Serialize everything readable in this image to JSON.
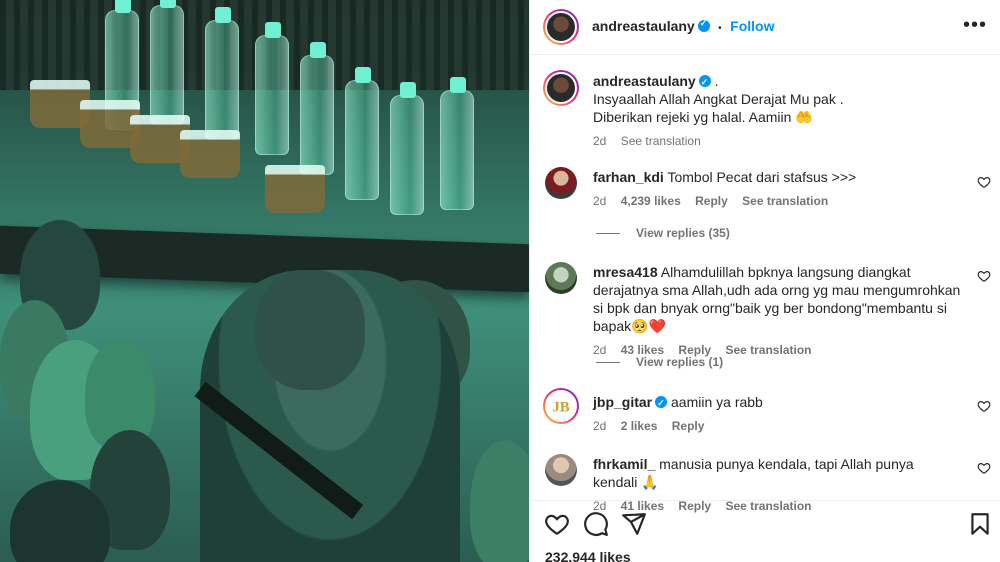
{
  "post": {
    "author": "andreastaulany",
    "follow_label": "Follow",
    "separator": "•",
    "more_label": "•••",
    "likes": "232.944 likes"
  },
  "caption": {
    "author": "andreastaulany",
    "dot": ".",
    "line1": "Insyaallah Allah Angkat Derajat Mu pak .",
    "line2": "Diberikan rejeki yg halal. Aamiin 🤲",
    "time": "2d",
    "see_translation": "See translation"
  },
  "comments": [
    {
      "user": "farhan_kdi",
      "verified": false,
      "text": "Tombol Pecat dari stafsus >>>",
      "time": "2d",
      "likes": "4,239 likes",
      "reply": "Reply",
      "see_translation": "See translation",
      "view_replies": "View replies (35)"
    },
    {
      "user": "mresa418",
      "verified": false,
      "text": "Alhamdulillah bpknya langsung diangkat derajatnya sma Allah,udh ada orng yg mau mengumrohkan si bpk dan bnyak orng\"baik yg ber bondong\"membantu si bapak🥺❤️",
      "time": "2d",
      "likes": "43 likes",
      "reply": "Reply",
      "see_translation": "See translation",
      "view_replies": "View replies (1)"
    },
    {
      "user": "jbp_gitar",
      "verified": true,
      "text": "aamiin ya rabb",
      "time": "2d",
      "likes": "2 likes",
      "reply": "Reply"
    },
    {
      "user": "fhrkamil_",
      "verified": false,
      "text": "manusia punya kendala, tapi Allah punya kendali 🙏",
      "time": "2d",
      "likes": "41 likes",
      "reply": "Reply",
      "see_translation": "See translation"
    }
  ],
  "icons": {
    "like": "heart-icon",
    "comment": "comment-icon",
    "share": "send-icon",
    "save": "bookmark-icon"
  },
  "colors": {
    "accent": "#0095f6",
    "secondary_text": "#737373",
    "heart_red": "#ed4956"
  }
}
